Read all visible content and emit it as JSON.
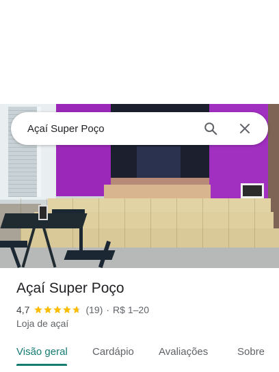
{
  "search": {
    "query": "Açaí Super Poço",
    "search_icon": "search-icon",
    "clear_icon": "close-icon"
  },
  "place": {
    "name": "Açaí Super Poço",
    "rating": "4,7",
    "rating_value": 4.7,
    "review_count": "(19)",
    "separator": "·",
    "price_range": "R$ 1–20",
    "category": "Loja de açaí"
  },
  "tabs": [
    {
      "label": "Visão geral",
      "active": true
    },
    {
      "label": "Cardápio",
      "active": false
    },
    {
      "label": "Avaliações",
      "active": false
    },
    {
      "label": "Sobre",
      "active": false
    }
  ],
  "colors": {
    "accent": "#137b72",
    "star": "#fbbc04",
    "text_primary": "#202124",
    "text_secondary": "#5f6368"
  }
}
